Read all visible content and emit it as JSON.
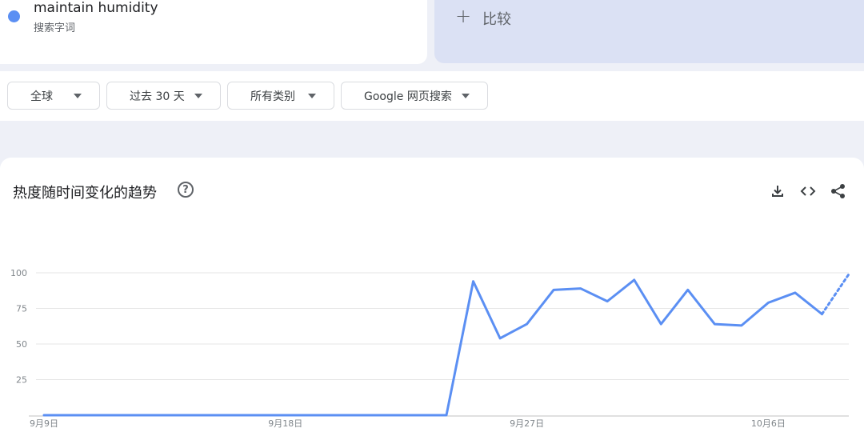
{
  "colors": {
    "series": "#5b8ff3",
    "grid": "#e6e6e6",
    "axis": "#c2c2c2"
  },
  "term": {
    "name": "maintain humidity",
    "type": "搜索字词"
  },
  "compare": {
    "icon": "plus-icon",
    "label": "比较"
  },
  "filters": [
    {
      "label": "全球"
    },
    {
      "label": "过去 30 天"
    },
    {
      "label": "所有类别"
    },
    {
      "label": "Google 网页搜索"
    }
  ],
  "chart_card": {
    "title": "热度随时间变化的趋势",
    "help_icon": "?",
    "actions": [
      "download-icon",
      "embed-icon",
      "share-icon"
    ]
  },
  "chart_data": {
    "type": "line",
    "title": "热度随时间变化的趋势",
    "xlabel": "",
    "ylabel": "",
    "ylim": [
      0,
      100
    ],
    "yticks": [
      25,
      50,
      75,
      100
    ],
    "grid": true,
    "x_tick_labels": [
      {
        "day": 0,
        "label": "9月9日"
      },
      {
        "day": 9,
        "label": "9月18日"
      },
      {
        "day": 18,
        "label": "9月27日"
      },
      {
        "day": 27,
        "label": "10月6日"
      }
    ],
    "series": [
      {
        "values": [
          0,
          0,
          0,
          0,
          0,
          0,
          0,
          0,
          0,
          0,
          0,
          0,
          0,
          0,
          0,
          0,
          94,
          54,
          64,
          88,
          89,
          80,
          95,
          64,
          88,
          64,
          63,
          79,
          86,
          71,
          99
        ],
        "partial_from_index": 29
      }
    ]
  }
}
